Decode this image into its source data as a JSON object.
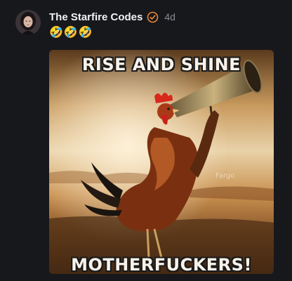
{
  "post": {
    "author": "The Starfire Codes",
    "timestamp": "4d",
    "text": "🤣🤣🤣",
    "icons": {
      "avatar": "avatar",
      "verified": "verified-badge-icon"
    },
    "colors": {
      "background": "#17181c",
      "verified_badge": "#e8863a"
    },
    "media": {
      "top_caption": "RISE AND SHINE",
      "bottom_caption": "MOTHERFUCKERS!",
      "watermark": "Fargo"
    }
  }
}
